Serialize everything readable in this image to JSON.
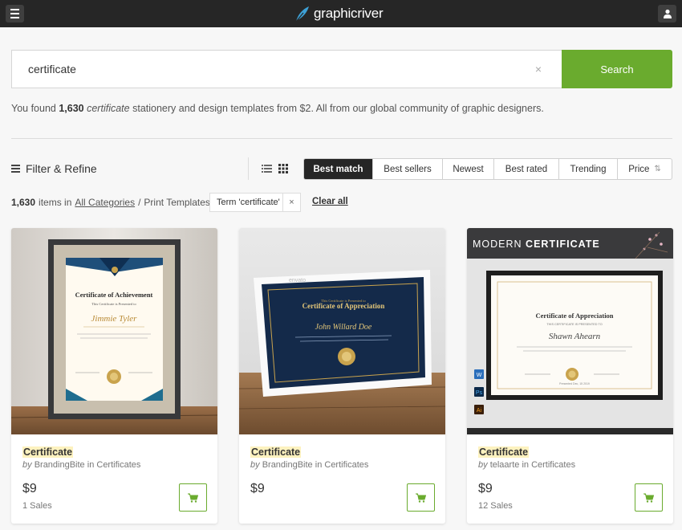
{
  "header": {
    "menu_icon": "hamburger-menu-icon",
    "logo_text": "graphicriver",
    "user_icon": "user-icon"
  },
  "search": {
    "value": "certificate",
    "clear_symbol": "×",
    "button_label": "Search",
    "accent_color": "#6aab2e"
  },
  "results": {
    "prefix": "You found",
    "count": "1,630",
    "term": "certificate",
    "suffix": "stationery and design templates from $2. All from our global community of graphic designers."
  },
  "toolbar": {
    "filter_label": "Filter & Refine",
    "sort_options": [
      "Best match",
      "Best sellers",
      "Newest",
      "Best rated",
      "Trending",
      "Price"
    ],
    "active_sort": "Best match",
    "price_arrows": "⇅"
  },
  "breadcrumb": {
    "count": "1,630",
    "items_in": "items in",
    "category_link": "All Categories",
    "separator": "/",
    "subcategory": "Print Templates",
    "term_chip": "Term 'certificate'",
    "chip_remove": "×",
    "clear_all": "Clear all"
  },
  "cards": [
    {
      "title": "Certificate",
      "by": "by",
      "author": "BrandingBite",
      "in_text": "in",
      "category": "Certificates",
      "price": "$9",
      "sales": "1 Sales",
      "image": {
        "heading": "Certificate of Achievement",
        "line": "This Certificate is Presented to",
        "name": "Jimmie Tyler"
      }
    },
    {
      "title": "Certificate",
      "by": "by",
      "author": "BrandingBite",
      "in_text": "in",
      "category": "Certificates",
      "price": "$9",
      "sales": "",
      "image": {
        "heading": "Certificate of Appreciation",
        "line": "This Certificate is Presented to",
        "name": "John Willard Doe",
        "watermark": "envato"
      }
    },
    {
      "title": "Certificate",
      "by": "by",
      "author": "telaarte",
      "in_text": "in",
      "category": "Certificates",
      "price": "$9",
      "sales": "12 Sales",
      "image": {
        "banner_light": "MODERN",
        "banner_bold": "CERTIFICATE",
        "heading": "Certificate of Appreciation",
        "line": "THIS CERTIFICATE IS PRESENTED TO",
        "name": "Shawn Ahearn",
        "footer": "Presented Dec, 15 2019"
      }
    }
  ]
}
